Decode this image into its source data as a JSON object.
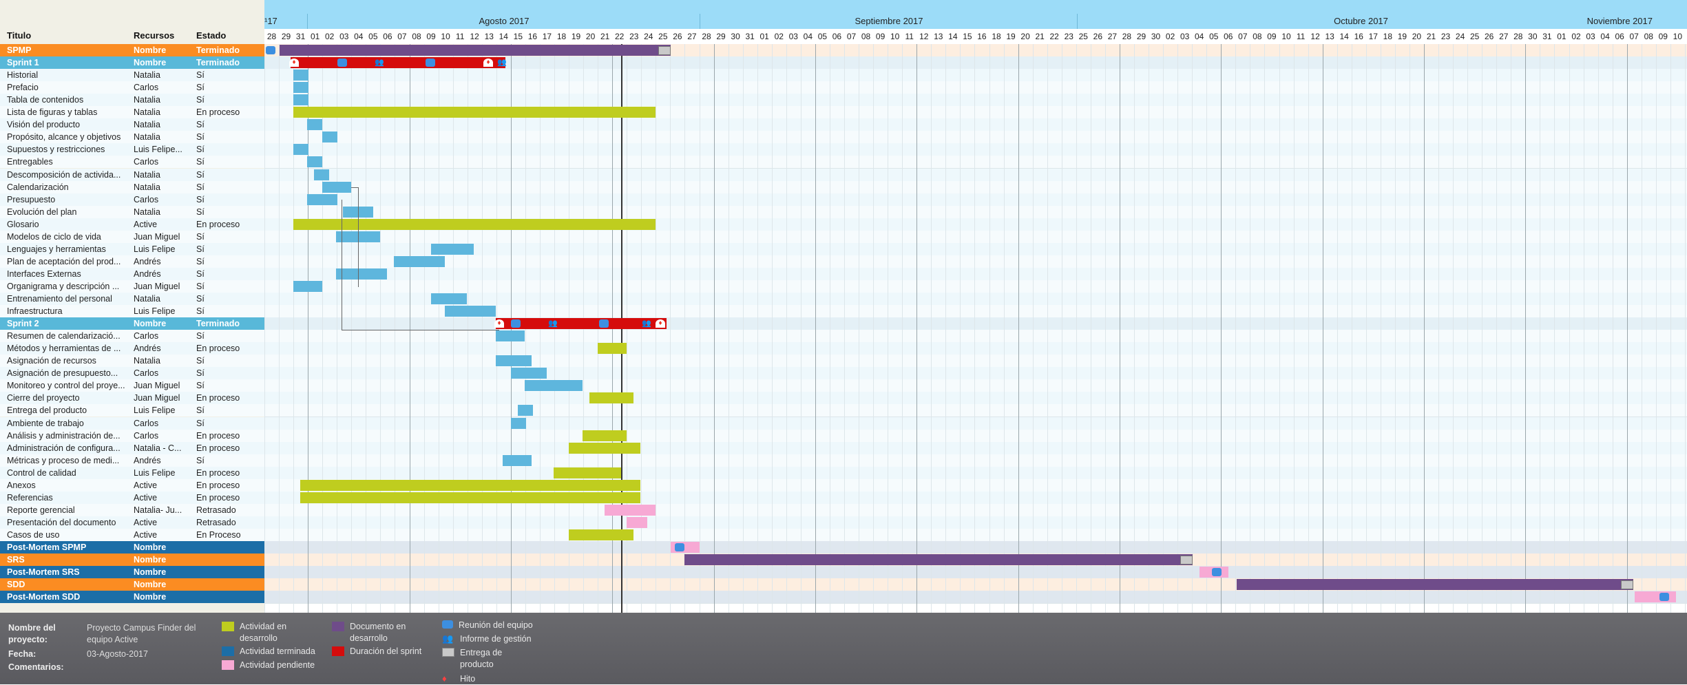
{
  "colors": {
    "in_progress": "#bfcd1f",
    "done": "#5eb6dd",
    "pending": "#f7a9d4",
    "document": "#6f4c8a",
    "sprint": "#d50c0c",
    "orange_row": "#fb8c22",
    "sprint_row": "#58b8d9",
    "dark_row": "#1c6ea7"
  },
  "headers": {
    "title": "Titulo",
    "resources": "Recursos",
    "status": "Estado"
  },
  "timeline": {
    "prev_month_fragment": "¹17",
    "months": [
      "Agosto 2017",
      "Septiembre 2017",
      "Octubre 2017",
      "Noviembre 2017"
    ],
    "days": [
      "28",
      "29",
      "31",
      "01",
      "02",
      "03",
      "04",
      "05",
      "06",
      "07",
      "08",
      "09",
      "10",
      "11",
      "12",
      "13",
      "14",
      "15",
      "16",
      "17",
      "18",
      "19",
      "20",
      "21",
      "22",
      "23",
      "24",
      "25",
      "26",
      "27",
      "28",
      "29",
      "30",
      "31",
      "01",
      "02",
      "03",
      "04",
      "05",
      "06",
      "07",
      "08",
      "09",
      "10",
      "11",
      "12",
      "13",
      "14",
      "15",
      "16",
      "18",
      "19",
      "20",
      "21",
      "22",
      "23",
      "25",
      "26",
      "27",
      "28",
      "29",
      "30",
      "02",
      "03",
      "04",
      "05",
      "06",
      "07",
      "08",
      "09",
      "10",
      "11",
      "12",
      "13",
      "14",
      "16",
      "17",
      "18",
      "19",
      "20",
      "21",
      "23",
      "24",
      "25",
      "26",
      "27",
      "28",
      "30",
      "31",
      "01",
      "02",
      "03",
      "04",
      "06",
      "07",
      "08",
      "09",
      "10",
      "11",
      "13",
      "14",
      "15",
      "16",
      "17",
      "18"
    ]
  },
  "rows": [
    {
      "title": "SPMP",
      "res": "Nombre",
      "status": "Terminado",
      "kind": "orange"
    },
    {
      "title": "Sprint 1",
      "res": "Nombre",
      "status": "Terminado",
      "kind": "sprint"
    },
    {
      "title": "Historial",
      "res": "Natalia",
      "status": "Sí",
      "kind": "task"
    },
    {
      "title": "Prefacio",
      "res": "Carlos",
      "status": "Sí",
      "kind": "task"
    },
    {
      "title": "Tabla de contenidos",
      "res": "Natalia",
      "status": "Sí",
      "kind": "task"
    },
    {
      "title": "Lista de figuras y tablas",
      "res": "Natalia",
      "status": "En proceso",
      "kind": "task"
    },
    {
      "title": "Visión del producto",
      "res": "Natalia",
      "status": "Sí",
      "kind": "task"
    },
    {
      "title": "Propósito, alcance y objetivos",
      "res": "Natalia",
      "status": "Sí",
      "kind": "task"
    },
    {
      "title": "Supuestos y restricciones",
      "res": "Luis Felipe...",
      "status": "Sí",
      "kind": "task"
    },
    {
      "title": "Entregables",
      "res": "Carlos",
      "status": "Sí",
      "kind": "task"
    },
    {
      "title": "Descomposición de activida...",
      "res": "Natalia",
      "status": "Sí",
      "kind": "task"
    },
    {
      "title": "Calendarización",
      "res": "Natalia",
      "status": "Sí",
      "kind": "task"
    },
    {
      "title": "Presupuesto",
      "res": "Carlos",
      "status": "Sí",
      "kind": "task"
    },
    {
      "title": "Evolución del plan",
      "res": "Natalia",
      "status": "Sí",
      "kind": "task"
    },
    {
      "title": "Glosario",
      "res": "Active",
      "status": "En proceso",
      "kind": "task"
    },
    {
      "title": "Modelos de ciclo de vida",
      "res": "Juan Miguel",
      "status": "Sí",
      "kind": "task"
    },
    {
      "title": "Lenguajes y herramientas",
      "res": "Luis Felipe",
      "status": "Sí",
      "kind": "task"
    },
    {
      "title": "Plan de aceptación del prod...",
      "res": "Andrés",
      "status": "Sí",
      "kind": "task"
    },
    {
      "title": "Interfaces Externas",
      "res": "Andrés",
      "status": "Sí",
      "kind": "task"
    },
    {
      "title": "Organigrama y descripción ...",
      "res": "Juan Miguel",
      "status": "Sí",
      "kind": "task"
    },
    {
      "title": "Entrenamiento del personal",
      "res": "Natalia",
      "status": "Sí",
      "kind": "task"
    },
    {
      "title": "Infraestructura",
      "res": "Luis Felipe",
      "status": "Sí",
      "kind": "task"
    },
    {
      "title": "Sprint 2",
      "res": "Nombre",
      "status": "Terminado",
      "kind": "sprint"
    },
    {
      "title": "Resumen de calendarizació...",
      "res": "Carlos",
      "status": "Sí",
      "kind": "task"
    },
    {
      "title": "Métodos y herramientas de ...",
      "res": "Andrés",
      "status": "En proceso",
      "kind": "task"
    },
    {
      "title": "Asignación de recursos",
      "res": "Natalia",
      "status": "Sí",
      "kind": "task"
    },
    {
      "title": "Asignación de presupuesto...",
      "res": "Carlos",
      "status": "Sí",
      "kind": "task"
    },
    {
      "title": "Monitoreo y control del proye...",
      "res": "Juan Miguel",
      "status": "Sí",
      "kind": "task"
    },
    {
      "title": "Cierre del proyecto",
      "res": "Juan Miguel",
      "status": "En proceso",
      "kind": "task"
    },
    {
      "title": "Entrega del producto",
      "res": "Luis Felipe",
      "status": "Sí",
      "kind": "task"
    },
    {
      "title": "Ambiente de trabajo",
      "res": "Carlos",
      "status": "Sí",
      "kind": "task"
    },
    {
      "title": "Análisis y administración de...",
      "res": "Carlos",
      "status": "En proceso",
      "kind": "task"
    },
    {
      "title": "Administración de configura...",
      "res": "Natalia - C...",
      "status": "En proceso",
      "kind": "task"
    },
    {
      "title": "Métricas y proceso de medi...",
      "res": "Andrés",
      "status": "Sí",
      "kind": "task"
    },
    {
      "title": "Control de calidad",
      "res": "Luis Felipe",
      "status": "En proceso",
      "kind": "task"
    },
    {
      "title": "Anexos",
      "res": "Active",
      "status": "En proceso",
      "kind": "task"
    },
    {
      "title": "Referencias",
      "res": "Active",
      "status": "En proceso",
      "kind": "task"
    },
    {
      "title": "Reporte gerencial",
      "res": "Natalia- Ju...",
      "status": "Retrasado",
      "kind": "task"
    },
    {
      "title": "Presentación del documento",
      "res": "Active",
      "status": "Retrasado",
      "kind": "task"
    },
    {
      "title": "Casos de uso",
      "res": "Active",
      "status": "En Proceso",
      "kind": "task"
    },
    {
      "title": "Post-Mortem SPMP",
      "res": "Nombre",
      "status": "",
      "kind": "dark"
    },
    {
      "title": "SRS",
      "res": "Nombre",
      "status": "",
      "kind": "orange"
    },
    {
      "title": "Post-Mortem SRS",
      "res": "Nombre",
      "status": "",
      "kind": "dark"
    },
    {
      "title": "SDD",
      "res": "Nombre",
      "status": "",
      "kind": "orange"
    },
    {
      "title": "Post-Mortem SDD",
      "res": "Nombre",
      "status": "",
      "kind": "dark"
    }
  ],
  "footer": {
    "project_name_label": "Nombre del proyecto:",
    "project_name": "Proyecto Campus Finder del equipo Active",
    "date_label": "Fecha:",
    "date": "03-Agosto-2017",
    "comments_label": "Comentarios:",
    "legend": {
      "in_progress": "Actividad en desarrollo",
      "done": "Actividad terminada",
      "pending": "Actividad pendiente",
      "document": "Documento en desarrollo",
      "sprint": "Duración del sprint",
      "meeting": "Reunión del equipo",
      "report": "Informe de gestión",
      "delivery": "Entrega de producto",
      "milestone": "Hito"
    }
  }
}
